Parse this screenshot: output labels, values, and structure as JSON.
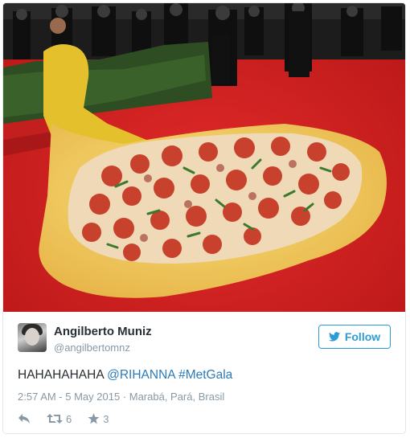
{
  "tweet": {
    "author_name": "Angilberto Muniz",
    "author_handle": "@angilbertomnz",
    "follow_label": "Follow",
    "text_plain": "HAHAHAHAHA ",
    "mention": "@RIHANNA",
    "hashtag": "#MetGala",
    "timestamp": "2:57 AM - 5 May 2015 · Marabá, Pará, Brasil",
    "retweet_count": "6",
    "favorite_count": "3"
  },
  "icons": {
    "reply": "reply-icon",
    "retweet": "retweet-icon",
    "favorite": "star-icon",
    "follow_bird": "twitter-bird-icon"
  },
  "colors": {
    "link": "#2b7bb9",
    "follow": "#2e9bd7",
    "muted": "#8899a6",
    "text": "#292f33"
  }
}
